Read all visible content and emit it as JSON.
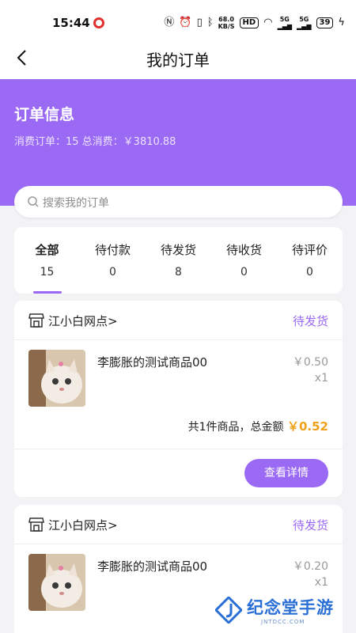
{
  "status_bar": {
    "time": "15:44",
    "net_speed_value": "68.0",
    "net_speed_unit": "KB/S",
    "hd_label": "HD",
    "signal1": "5G",
    "signal2": "5G",
    "battery": "39"
  },
  "nav": {
    "title": "我的订单",
    "back_icon": "chevron-left-icon"
  },
  "header": {
    "title": "订单信息",
    "summary": "消费订单：15 总消费：￥3810.88",
    "accent_color": "#9b6af4"
  },
  "search": {
    "placeholder": "搜索我的订单",
    "icon": "search-icon"
  },
  "tabs": [
    {
      "label": "全部",
      "count": "15",
      "active": true
    },
    {
      "label": "待付款",
      "count": "0"
    },
    {
      "label": "待发货",
      "count": "8"
    },
    {
      "label": "待收货",
      "count": "0"
    },
    {
      "label": "待评价",
      "count": "0"
    }
  ],
  "orders": [
    {
      "store": "江小白网点",
      "store_chevron": ">",
      "status": "待发货",
      "product_name": "李膨胀的测试商品00",
      "price": "￥0.50",
      "qty": "x1",
      "summary_prefix": "共1件商品，总金额",
      "total": "￥0.52",
      "detail_button": "查看详情"
    },
    {
      "store": "江小白网点",
      "store_chevron": ">",
      "status": "待发货",
      "product_name": "李膨胀的测试商品00",
      "price": "￥0.20",
      "qty": "x1"
    }
  ],
  "watermark": {
    "text": "纪念堂手游",
    "sub": "JNTDCC.COM"
  }
}
